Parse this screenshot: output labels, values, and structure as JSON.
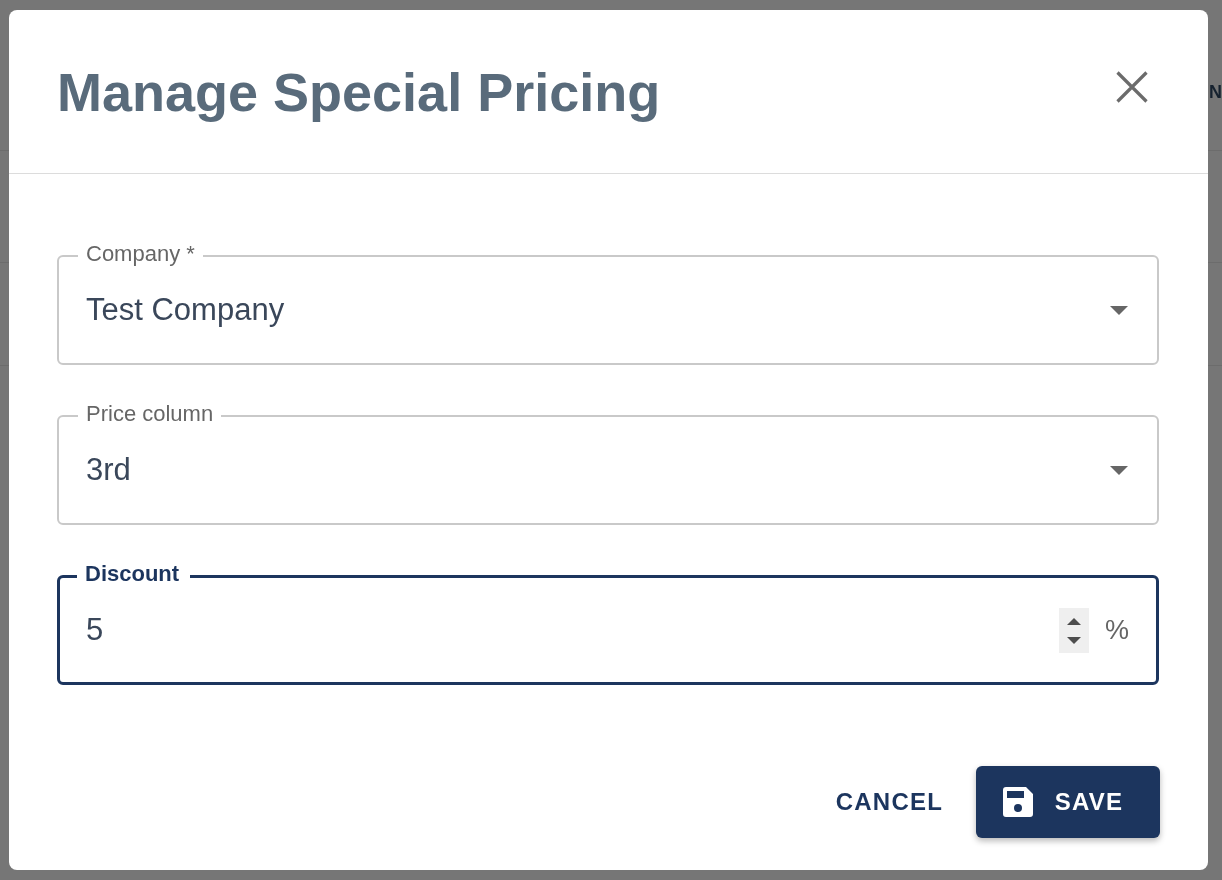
{
  "background": {
    "text": "N"
  },
  "dialog": {
    "title": "Manage Special Pricing",
    "fields": [
      {
        "kind": "select",
        "label": "Company *",
        "value": "Test Company",
        "focused": false
      },
      {
        "kind": "select",
        "label": "Price column",
        "value": "3rd",
        "focused": false
      },
      {
        "kind": "number",
        "label": "Discount",
        "value": "5",
        "suffix": "%",
        "focused": true
      }
    ],
    "actions": [
      {
        "kind": "text",
        "label": "CANCEL"
      },
      {
        "kind": "primary",
        "label": "SAVE"
      }
    ]
  }
}
